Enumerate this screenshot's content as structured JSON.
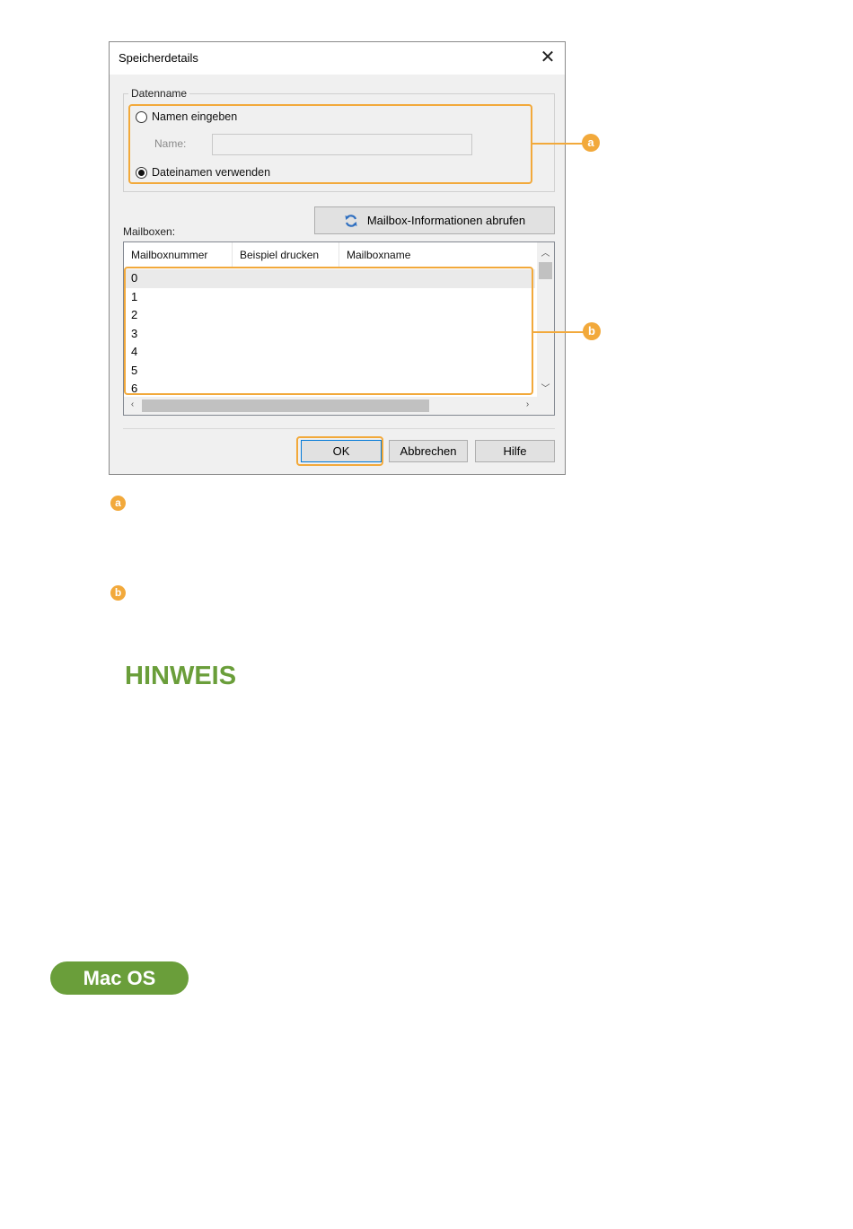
{
  "dialog": {
    "title": "Speicherdetails",
    "close_glyph": "✕",
    "datenname": {
      "group_label": "Datenname",
      "option_enter_name": "Namen eingeben",
      "name_label": "Name:",
      "name_value": "",
      "option_use_filename": "Dateinamen verwenden",
      "selected": "Dateinamen verwenden"
    },
    "mailboxes_label": "Mailboxen:",
    "fetch_button": "Mailbox-Informationen abrufen",
    "list": {
      "columns": [
        "Mailboxnummer",
        "Beispiel drucken",
        "Mailboxname"
      ],
      "rows": [
        "0",
        "1",
        "2",
        "3",
        "4",
        "5",
        "6"
      ],
      "selected_row": "0"
    },
    "buttons": {
      "ok": "OK",
      "cancel": "Abbrechen",
      "help": "Hilfe"
    }
  },
  "callouts": {
    "a": "a",
    "b": "b"
  },
  "note_heading": "HINWEIS",
  "os_badge": "Mac OS",
  "colors": {
    "callout": "#f2a93b",
    "note_green": "#6a9e3a",
    "dialog_bg": "#f0f0f0"
  }
}
